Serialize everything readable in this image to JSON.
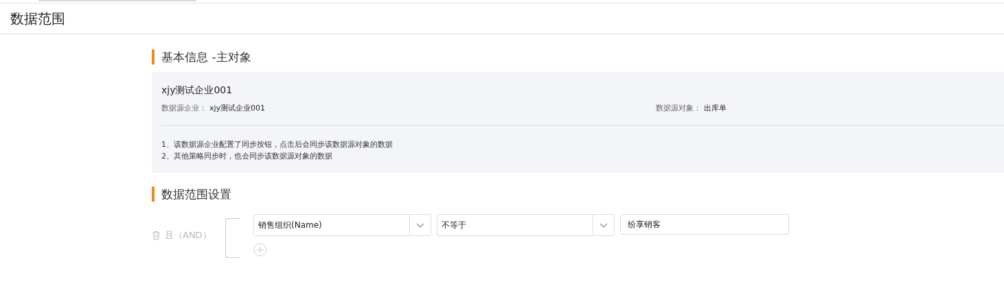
{
  "page_title": "数据范围",
  "basic_info": {
    "title": "基本信息 -主对象",
    "name": "xjy测试企业001",
    "fields": [
      {
        "label": "数据源企业：",
        "value": "xjy测试企业001"
      },
      {
        "label": "数据源对象：",
        "value": "出库单"
      }
    ],
    "notes": [
      "1、该数据源企业配置了同步按钮，点击后会同步该数据源对象的数据",
      "2、其他策略同步时，也会同步该数据源对象的数据"
    ]
  },
  "range_settings": {
    "title": "数据范围设置",
    "group_label": "且（AND）",
    "conditions": [
      {
        "field": "销售组织(Name)",
        "operator": "不等于",
        "value": "纷享销客"
      }
    ]
  }
}
